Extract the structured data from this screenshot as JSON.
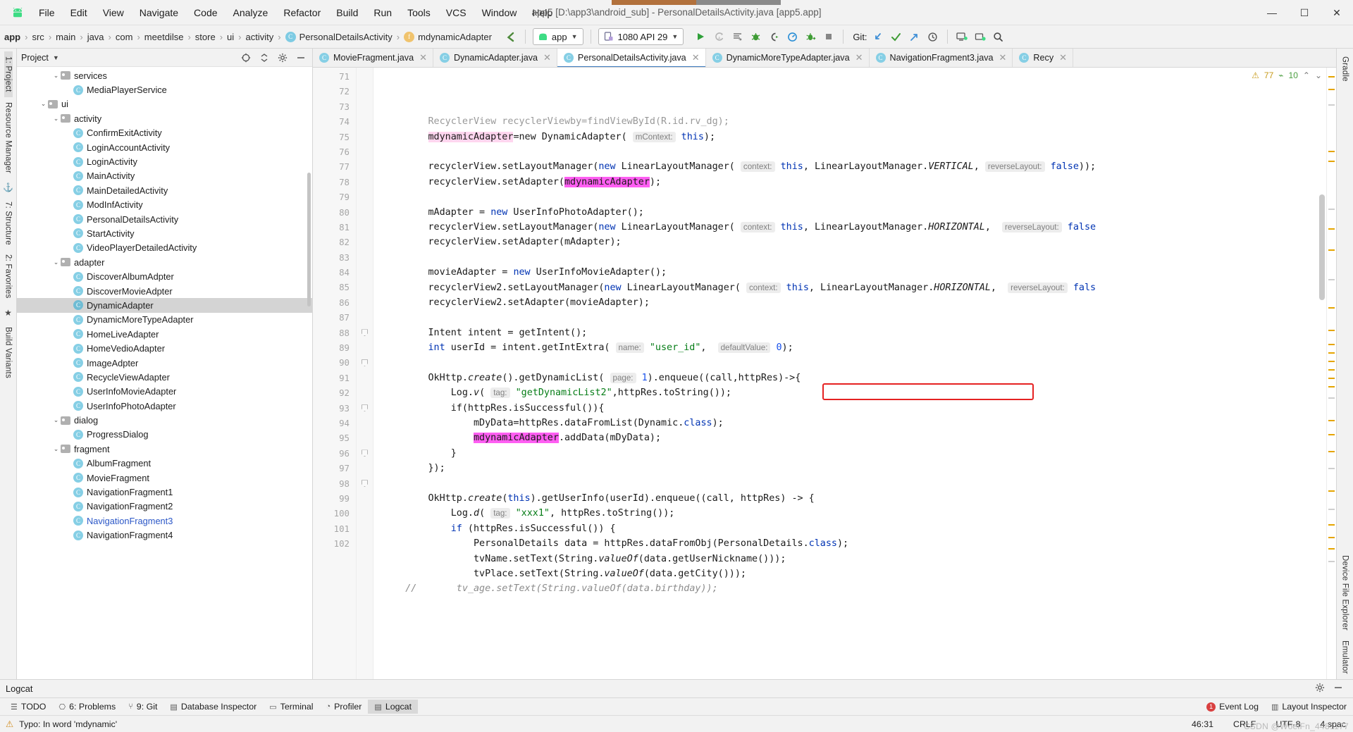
{
  "titlebar": {
    "logo": "android-logo",
    "menus": [
      "File",
      "Edit",
      "View",
      "Navigate",
      "Code",
      "Analyze",
      "Refactor",
      "Build",
      "Run",
      "Tools",
      "VCS",
      "Window",
      "Help"
    ],
    "title": "app5 [D:\\app3\\android_sub] - PersonalDetailsActivity.java [app5.app]",
    "minimize": "—",
    "maximize": "☐",
    "close": "✕"
  },
  "navbar": {
    "breadcrumbs": [
      {
        "label": "app",
        "icon": "",
        "bold": true
      },
      {
        "label": "src",
        "icon": ""
      },
      {
        "label": "main",
        "icon": ""
      },
      {
        "label": "java",
        "icon": ""
      },
      {
        "label": "com",
        "icon": ""
      },
      {
        "label": "meetdilse",
        "icon": ""
      },
      {
        "label": "store",
        "icon": ""
      },
      {
        "label": "ui",
        "icon": ""
      },
      {
        "label": "activity",
        "icon": ""
      },
      {
        "label": "PersonalDetailsActivity",
        "icon": "c"
      },
      {
        "label": "mdynamicAdapter",
        "icon": "f"
      }
    ],
    "separator": "›",
    "back_icon": "back-arrow-icon",
    "module_selector": "app",
    "device_selector": "1080 API 29",
    "run_icon": "run-icon",
    "rerun_icon": "rerun-icon",
    "applychanges_icon": "apply-changes-icon",
    "debug_icon": "debug-icon",
    "attach_icon": "attach-debugger-icon",
    "profiler_icon": "profiler-icon",
    "coverage_icon": "run-coverage-icon",
    "stop_icon": "stop-icon",
    "git_label": "Git:",
    "git_update_icon": "update-project-icon",
    "git_commit_icon": "commit-icon",
    "git_push_icon": "push-icon",
    "history_icon": "history-icon",
    "avd_icon": "avd-manager-icon",
    "sdk_icon": "sdk-manager-icon",
    "search_icon": "search-everywhere-icon"
  },
  "left_rail": {
    "items": [
      "1: Project",
      "Resource Manager",
      "7: Structure",
      "2: Favorites",
      "Build Variants"
    ],
    "pin_icon": "pin-icon",
    "star_icon": "favorites-star-icon"
  },
  "right_rail": {
    "items": [
      "Gradle",
      "Device File Explorer",
      "Emulator"
    ]
  },
  "project_panel": {
    "title": "Project",
    "dropdown_icon": "chevron-down-icon",
    "locate_icon": "locate-target-icon",
    "collapse_icon": "collapse-all-icon",
    "settings_icon": "gear-icon",
    "hide_icon": "hide-panel-icon",
    "tree": [
      {
        "label": "services",
        "type": "folder",
        "indent": 3,
        "expanded": true
      },
      {
        "label": "MediaPlayerService",
        "type": "class",
        "indent": 4
      },
      {
        "label": "ui",
        "type": "folder",
        "indent": 2,
        "expanded": true
      },
      {
        "label": "activity",
        "type": "folder",
        "indent": 3,
        "expanded": true
      },
      {
        "label": "ConfirmExitActivity",
        "type": "class",
        "indent": 4
      },
      {
        "label": "LoginAccountActivity",
        "type": "class",
        "indent": 4
      },
      {
        "label": "LoginActivity",
        "type": "class",
        "indent": 4
      },
      {
        "label": "MainActivity",
        "type": "class",
        "indent": 4
      },
      {
        "label": "MainDetailedActivity",
        "type": "class",
        "indent": 4
      },
      {
        "label": "ModInfActivity",
        "type": "class",
        "indent": 4
      },
      {
        "label": "PersonalDetailsActivity",
        "type": "class",
        "indent": 4
      },
      {
        "label": "StartActivity",
        "type": "class",
        "indent": 4
      },
      {
        "label": "VideoPlayerDetailedActivity",
        "type": "class",
        "indent": 4
      },
      {
        "label": "adapter",
        "type": "folder",
        "indent": 3,
        "expanded": true
      },
      {
        "label": "DiscoverAlbumAdpter",
        "type": "class",
        "indent": 4
      },
      {
        "label": "DiscoverMovieAdpter",
        "type": "class",
        "indent": 4
      },
      {
        "label": "DynamicAdapter",
        "type": "class",
        "indent": 4,
        "selected": true
      },
      {
        "label": "DynamicMoreTypeAdapter",
        "type": "class",
        "indent": 4
      },
      {
        "label": "HomeLiveAdapter",
        "type": "class",
        "indent": 4
      },
      {
        "label": "HomeVedioAdapter",
        "type": "class",
        "indent": 4
      },
      {
        "label": "ImageAdpter",
        "type": "class",
        "indent": 4
      },
      {
        "label": "RecycleViewAdapter",
        "type": "class",
        "indent": 4
      },
      {
        "label": "UserInfoMovieAdapter",
        "type": "class",
        "indent": 4
      },
      {
        "label": "UserInfoPhotoAdapter",
        "type": "class",
        "indent": 4
      },
      {
        "label": "dialog",
        "type": "folder",
        "indent": 3,
        "expanded": true
      },
      {
        "label": "ProgressDialog",
        "type": "class",
        "indent": 4
      },
      {
        "label": "fragment",
        "type": "folder",
        "indent": 3,
        "expanded": true
      },
      {
        "label": "AlbumFragment",
        "type": "class",
        "indent": 4
      },
      {
        "label": "MovieFragment",
        "type": "class",
        "indent": 4
      },
      {
        "label": "NavigationFragment1",
        "type": "class",
        "indent": 4
      },
      {
        "label": "NavigationFragment2",
        "type": "class",
        "indent": 4
      },
      {
        "label": "NavigationFragment3",
        "type": "class",
        "indent": 4,
        "link": true
      },
      {
        "label": "NavigationFragment4",
        "type": "class",
        "indent": 4
      }
    ]
  },
  "editor": {
    "tabs": [
      {
        "label": "MovieFragment.java",
        "active": false
      },
      {
        "label": "DynamicAdapter.java",
        "active": false
      },
      {
        "label": "PersonalDetailsActivity.java",
        "active": true
      },
      {
        "label": "DynamicMoreTypeAdapter.java",
        "active": false
      },
      {
        "label": "NavigationFragment3.java",
        "active": false
      },
      {
        "label": "Recy",
        "active": false
      }
    ],
    "close_icon": "close-tab-icon",
    "inspection": {
      "warning_icon": "warning-triangle-icon",
      "warning_count": "77",
      "weak_warning_icon": "weak-warning-icon",
      "weak_warning_count": "10",
      "up_icon": "prev-highlight-icon",
      "down_icon": "next-highlight-icon"
    },
    "first_line_number": 71,
    "lines": [
      {
        "n": 71,
        "html": "        RecyclerView recyclerViewby=findViewById(R.id.rv_dg);",
        "faded": true
      },
      {
        "n": 72,
        "html": "        <span class=\"hl-pink\">mdynamicAdapter</span>=new DynamicAdapter( <span class=\"hint\">mContext:</span> <span class=\"kw\">this</span>);"
      },
      {
        "n": 73,
        "html": ""
      },
      {
        "n": 74,
        "html": "        recyclerView.setLayoutManager(<span class=\"kw\">new</span> LinearLayoutManager( <span class=\"hint\">context:</span> <span class=\"kw\">this</span>, LinearLayoutManager.<span class=\"it\">VERTICAL</span>, <span class=\"hint\">reverseLayout:</span> <span class=\"kw\">false</span>));"
      },
      {
        "n": 75,
        "html": "        recyclerView.setAdapter(<span class=\"hl-mag\">mdynamicAdapter</span>);"
      },
      {
        "n": 76,
        "html": ""
      },
      {
        "n": 77,
        "html": "        mAdapter = <span class=\"kw\">new</span> UserInfoPhotoAdapter();"
      },
      {
        "n": 78,
        "html": "        recyclerView.setLayoutManager(<span class=\"kw\">new</span> LinearLayoutManager( <span class=\"hint\">context:</span> <span class=\"kw\">this</span>, LinearLayoutManager.<span class=\"it\">HORIZONTAL</span>,  <span class=\"hint\">reverseLayout:</span> <span class=\"kw\">false</span>"
      },
      {
        "n": 79,
        "html": "        recyclerView.setAdapter(mAdapter);"
      },
      {
        "n": 80,
        "html": ""
      },
      {
        "n": 81,
        "html": "        movieAdapter = <span class=\"kw\">new</span> UserInfoMovieAdapter();"
      },
      {
        "n": 82,
        "html": "        recyclerView2.setLayoutManager(<span class=\"kw\">new</span> LinearLayoutManager( <span class=\"hint\">context:</span> <span class=\"kw\">this</span>, LinearLayoutManager.<span class=\"it\">HORIZONTAL</span>,  <span class=\"hint\">reverseLayout:</span> <span class=\"kw\">fals</span>"
      },
      {
        "n": 83,
        "html": "        recyclerView2.setAdapter(movieAdapter);"
      },
      {
        "n": 84,
        "html": ""
      },
      {
        "n": 85,
        "html": "        Intent intent = getIntent();"
      },
      {
        "n": 86,
        "html": "        <span class=\"kw\">int</span> userId = intent.getIntExtra( <span class=\"hint\">name:</span> <span class=\"str\">\"user_id\"</span>,  <span class=\"hint\">defaultValue:</span> <span class=\"num\">0</span>);"
      },
      {
        "n": 87,
        "html": ""
      },
      {
        "n": 88,
        "html": "        OkHttp.<span class=\"it\">create</span>().getDynamicList( <span class=\"hint\">page:</span> <span class=\"num\">1</span>).enqueue((call,httpRes)-&gt;{",
        "fold": true
      },
      {
        "n": 89,
        "html": "            Log.<span class=\"it\">v</span>( <span class=\"hint\">tag:</span> <span class=\"str\">\"getDynamicList2\"</span>,httpRes.toString());"
      },
      {
        "n": 90,
        "html": "            if(httpRes.isSuccessful()){",
        "fold": true
      },
      {
        "n": 91,
        "html": "                mDyData=httpRes.dataFromList(Dynamic.<span class=\"kw\">class</span>);"
      },
      {
        "n": 92,
        "html": "                <span class=\"hl-mag\">mdynamicAdapter</span>.addData(mDyData);"
      },
      {
        "n": 93,
        "html": "            }",
        "fold": true
      },
      {
        "n": 94,
        "html": "        });"
      },
      {
        "n": 95,
        "html": ""
      },
      {
        "n": 96,
        "html": "        OkHttp.<span class=\"it\">create</span>(<span class=\"kw\">this</span>).getUserInfo(userId).enqueue((call, httpRes) -&gt; {",
        "fold": true
      },
      {
        "n": 97,
        "html": "            Log.<span class=\"it\">d</span>( <span class=\"hint\">tag:</span> <span class=\"str\">\"xxx1\"</span>, httpRes.toString());"
      },
      {
        "n": 98,
        "html": "            <span class=\"kw\">if</span> (httpRes.isSuccessful()) {",
        "fold": true
      },
      {
        "n": 99,
        "html": "                PersonalDetails data = httpRes.dataFromObj(PersonalDetails.<span class=\"kw\">class</span>);"
      },
      {
        "n": 100,
        "html": "                tvName.setText(String.<span class=\"it\">valueOf</span>(data.getUserNickname()));"
      },
      {
        "n": 101,
        "html": "                tvPlace.setText(String.<span class=\"it\">valueOf</span>(data.getCity()));"
      },
      {
        "n": 102,
        "html": "    <span class=\"cm\">//       tv_age.setText(String.valueOf(data.birthday));</span>"
      }
    ]
  },
  "logcat_panel": {
    "title": "Logcat",
    "settings_icon": "gear-icon",
    "hide_icon": "hide-panel-icon"
  },
  "toolwindow_bar": {
    "items": [
      {
        "label": "TODO",
        "icon": "todo-icon"
      },
      {
        "label": "6: Problems",
        "icon": "problems-icon"
      },
      {
        "label": "9: Git",
        "icon": "git-icon"
      },
      {
        "label": "Database Inspector",
        "icon": "database-icon"
      },
      {
        "label": "Terminal",
        "icon": "terminal-icon"
      },
      {
        "label": "Profiler",
        "icon": "profiler-icon"
      },
      {
        "label": "Logcat",
        "icon": "logcat-icon",
        "selected": true
      }
    ],
    "event_log": "Event Log",
    "event_badge": "1",
    "layout_inspector": "Layout Inspector"
  },
  "status_bar": {
    "error_icon": "typo-warning-icon",
    "message": "Typo: In word 'mdynamic'",
    "caret": "46:31",
    "line_sep": "CRLF",
    "encoding": "UTF-8",
    "indent": "4 spac",
    "watermark": "CSDN @WoeiFn_4481177"
  }
}
